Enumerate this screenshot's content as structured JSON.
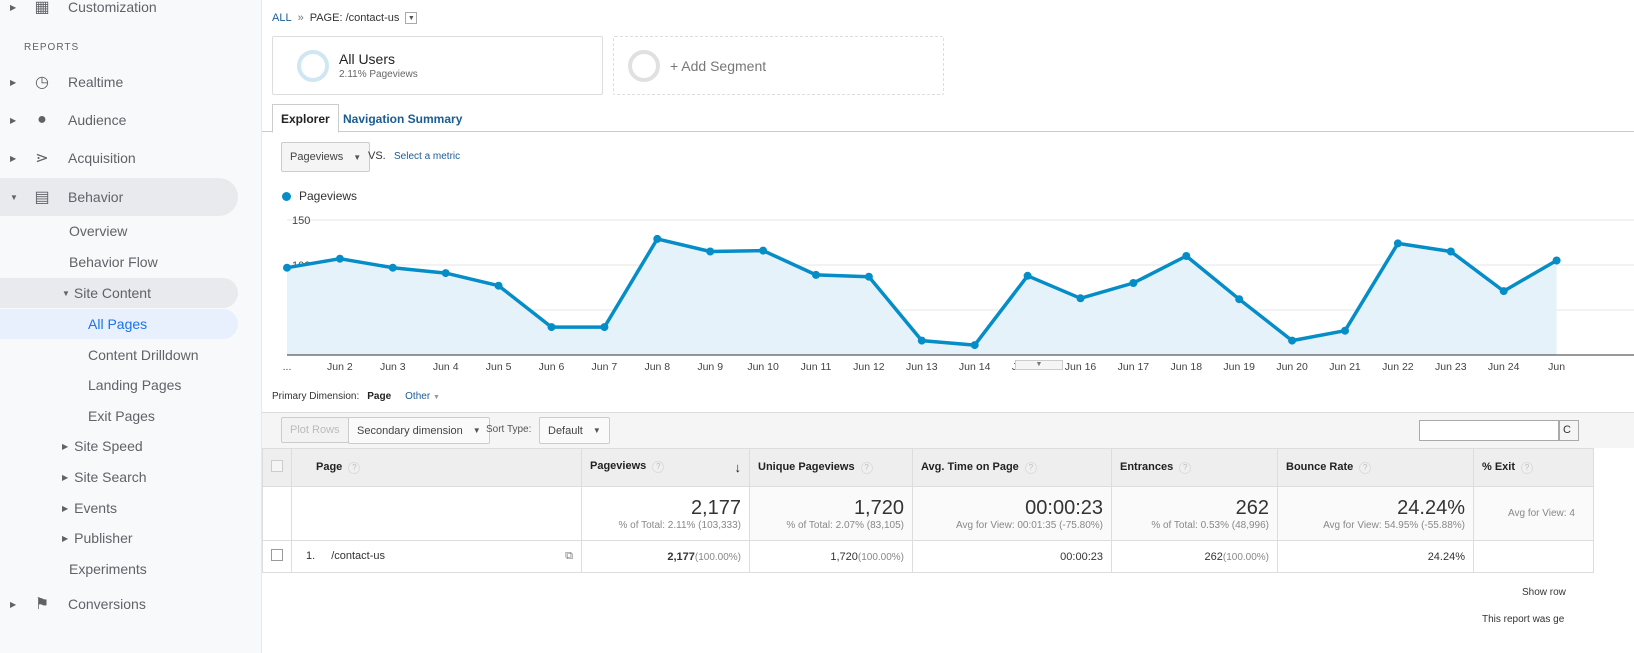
{
  "sidebar": {
    "customization": "Customization",
    "reports_heading": "REPORTS",
    "items": [
      {
        "label": "Realtime",
        "icon": "clock-icon"
      },
      {
        "label": "Audience",
        "icon": "person-icon"
      },
      {
        "label": "Acquisition",
        "icon": "acquisition-icon"
      },
      {
        "label": "Behavior",
        "icon": "behavior-icon"
      }
    ],
    "behavior_sub": [
      "Overview",
      "Behavior Flow",
      "Site Content"
    ],
    "site_content_sub": [
      "All Pages",
      "Content Drilldown",
      "Landing Pages",
      "Exit Pages"
    ],
    "behavior_sub2": [
      "Site Speed",
      "Site Search",
      "Events",
      "Publisher"
    ],
    "experiments": "Experiments",
    "conversions": "Conversions"
  },
  "breadcrumb": {
    "all": "ALL",
    "sep": "»",
    "page": "PAGE: /contact-us"
  },
  "segments": {
    "name": "All Users",
    "sub": "2.11% Pageviews",
    "add": "+ Add Segment"
  },
  "tabs": [
    "Explorer",
    "Navigation Summary"
  ],
  "metric": {
    "selected": "Pageviews",
    "vs": "VS.",
    "select": "Select a metric"
  },
  "chart_data": {
    "type": "area",
    "legend": "Pageviews",
    "color": "#058dc7",
    "yticks": [
      "150",
      "100",
      "50"
    ],
    "ylim": [
      0,
      150
    ],
    "grid": true,
    "categories": [
      "...",
      "Jun 2",
      "Jun 3",
      "Jun 4",
      "Jun 5",
      "Jun 6",
      "Jun 7",
      "Jun 8",
      "Jun 9",
      "Jun 10",
      "Jun 11",
      "Jun 12",
      "Jun 13",
      "Jun 14",
      "Jun 15",
      "Jun 16",
      "Jun 17",
      "Jun 18",
      "Jun 19",
      "Jun 20",
      "Jun 21",
      "Jun 22",
      "Jun 23",
      "Jun 24",
      "Jun"
    ],
    "values": [
      97,
      107,
      97,
      91,
      77,
      31,
      31,
      129,
      115,
      116,
      89,
      87,
      16,
      11,
      88,
      63,
      80,
      110,
      62,
      16,
      27,
      124,
      115,
      71,
      105
    ]
  },
  "dimension": {
    "label": "Primary Dimension:",
    "page": "Page",
    "other": "Other"
  },
  "toolbar": {
    "plot_rows": "Plot Rows",
    "secondary": "Secondary dimension",
    "sort_label": "Sort Type:",
    "sort_value": "Default",
    "search_btn": "C"
  },
  "table": {
    "headers": [
      "Page",
      "Pageviews",
      "Unique Pageviews",
      "Avg. Time on Page",
      "Entrances",
      "Bounce Rate",
      "% Exit"
    ],
    "totals": [
      {
        "value": "2,177",
        "sub": "% of Total: 2.11% (103,333)"
      },
      {
        "value": "1,720",
        "sub": "% of Total: 2.07% (83,105)"
      },
      {
        "value": "00:00:23",
        "sub": "Avg for View: 00:01:35 (-75.80%)"
      },
      {
        "value": "262",
        "sub": "% of Total: 0.53% (48,996)"
      },
      {
        "value": "24.24%",
        "sub": "Avg for View: 54.95% (-55.88%)"
      },
      {
        "value": "",
        "sub": "Avg for View: 4"
      }
    ],
    "rows": [
      {
        "index": "1.",
        "page": "/contact-us",
        "pageviews": "2,177",
        "pageviews_pct": "(100.00%)",
        "unique": "1,720",
        "unique_pct": "(100.00%)",
        "avg_time": "00:00:23",
        "entrances": "262",
        "entrances_pct": "(100.00%)",
        "bounce": "24.24%",
        "exit": ""
      }
    ]
  },
  "footer": {
    "show_rows": "Show row",
    "report_note": "This report was ge"
  }
}
